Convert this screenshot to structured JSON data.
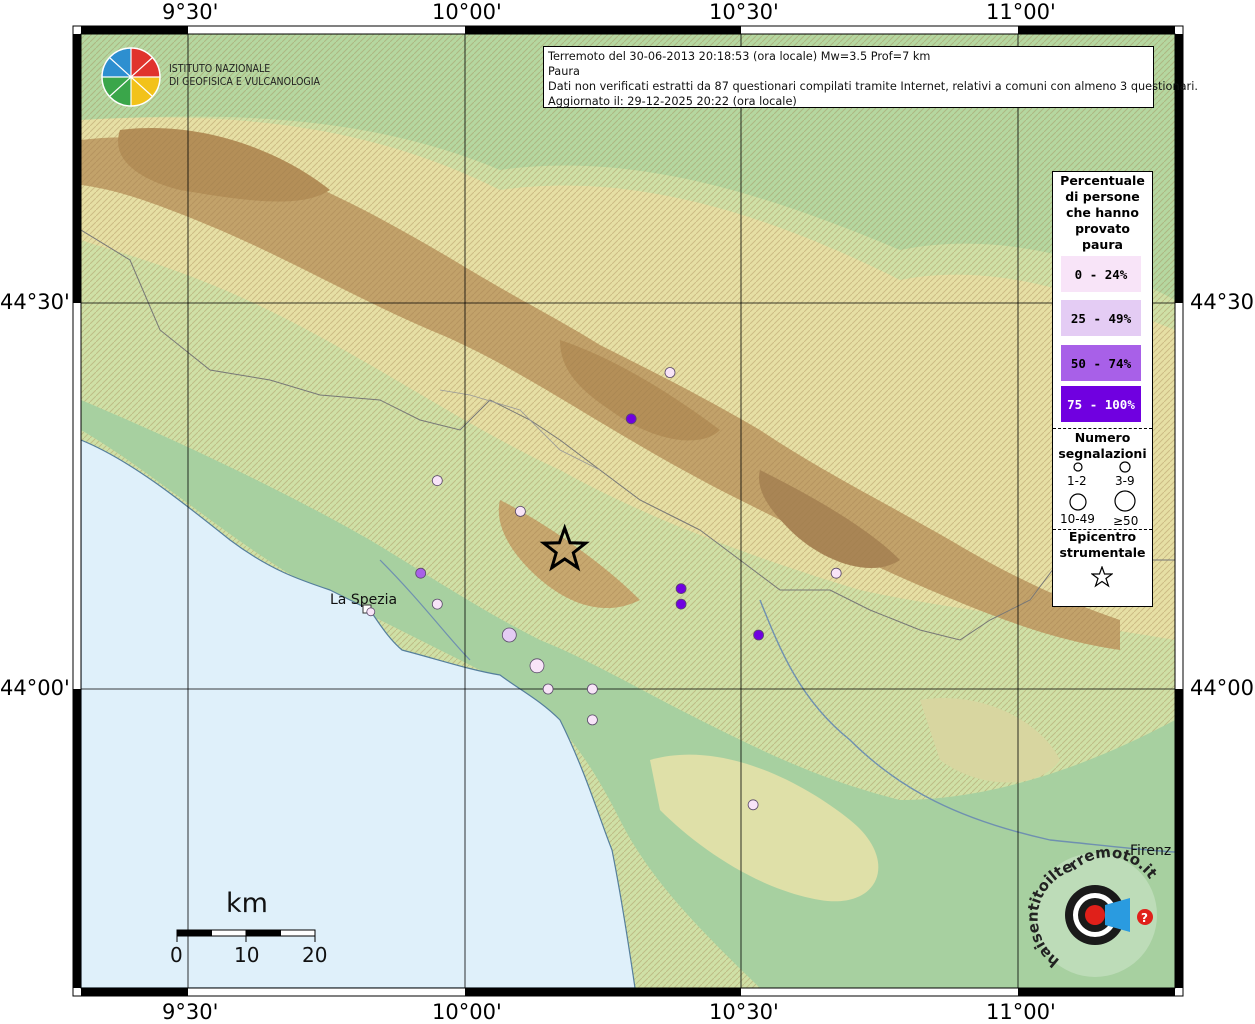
{
  "header": {
    "line1": "Terremoto del 30-06-2013 20:18:53 (ora locale) Mw=3.5 Prof=7 km",
    "line2": "Paura",
    "line3": "Dati non verificati estratti da 87 questionari compilati tramite Internet, relativi a comuni con almeno 3 questionari.",
    "line4": "Aggiornato il: 29-12-2025 20:22 (ora locale)"
  },
  "institute": {
    "line1": "ISTITUTO NAZIONALE",
    "line2": "DI GEOFISICA E VULCANOLOGIA"
  },
  "axes": {
    "lon_ticks": [
      "9°30'",
      "10°00'",
      "10°30'",
      "11°00'"
    ],
    "lat_ticks": [
      "44°30'",
      "44°00'"
    ]
  },
  "legend": {
    "title": [
      "Percentuale",
      "di persone",
      "che hanno",
      "provato",
      "paura"
    ],
    "classes": [
      {
        "label": "0 - 24%",
        "color": "#f8e4f8"
      },
      {
        "label": "25 - 49%",
        "color": "#e4ccf4"
      },
      {
        "label": "50 - 74%",
        "color": "#a860e8"
      },
      {
        "label": "75 - 100%",
        "color": "#7000e0"
      }
    ],
    "count_title": [
      "Numero",
      "segnalazioni"
    ],
    "count_classes": [
      "1-2",
      "3-9",
      "10-49",
      "≥50"
    ],
    "epicenter_title": [
      "Epicentro",
      "strumentale"
    ]
  },
  "places": {
    "la_spezia": "La Spezia",
    "firenze": "Firenz"
  },
  "scale": {
    "unit": "km",
    "ticks": [
      "0",
      "10",
      "20"
    ]
  },
  "colors": {
    "sea": "#dff0fa",
    "lowland": "#a9d3a2",
    "hills": "#e8e2a8",
    "mountains": "#b8955e",
    "frame": "#000000"
  },
  "map_data": {
    "epicenter": {
      "lon": 10.18,
      "lat": 44.18
    },
    "points": [
      {
        "lon": 10.37,
        "lat": 44.41,
        "class": 0,
        "size": "3-9"
      },
      {
        "lon": 10.3,
        "lat": 44.35,
        "class": 3,
        "size": "3-9"
      },
      {
        "lon": 9.95,
        "lat": 44.27,
        "class": 0,
        "size": "3-9"
      },
      {
        "lon": 10.1,
        "lat": 44.23,
        "class": 0,
        "size": "3-9"
      },
      {
        "lon": 9.92,
        "lat": 44.15,
        "class": 2,
        "size": "3-9"
      },
      {
        "lon": 9.95,
        "lat": 44.11,
        "class": 0,
        "size": "3-9"
      },
      {
        "lon": 9.83,
        "lat": 44.1,
        "class": 0,
        "size": "1-2"
      },
      {
        "lon": 10.08,
        "lat": 44.07,
        "class": 1,
        "size": "10-49"
      },
      {
        "lon": 10.13,
        "lat": 44.03,
        "class": 0,
        "size": "10-49"
      },
      {
        "lon": 10.39,
        "lat": 44.13,
        "class": 3,
        "size": "3-9"
      },
      {
        "lon": 10.39,
        "lat": 44.11,
        "class": 3,
        "size": "3-9"
      },
      {
        "lon": 10.53,
        "lat": 44.07,
        "class": 3,
        "size": "3-9"
      },
      {
        "lon": 10.67,
        "lat": 44.15,
        "class": 0,
        "size": "3-9"
      },
      {
        "lon": 10.15,
        "lat": 44.0,
        "class": 0,
        "size": "3-9"
      },
      {
        "lon": 10.23,
        "lat": 44.0,
        "class": 0,
        "size": "3-9"
      },
      {
        "lon": 10.23,
        "lat": 43.96,
        "class": 0,
        "size": "3-9"
      },
      {
        "lon": 10.52,
        "lat": 43.85,
        "class": 0,
        "size": "3-9"
      }
    ]
  }
}
